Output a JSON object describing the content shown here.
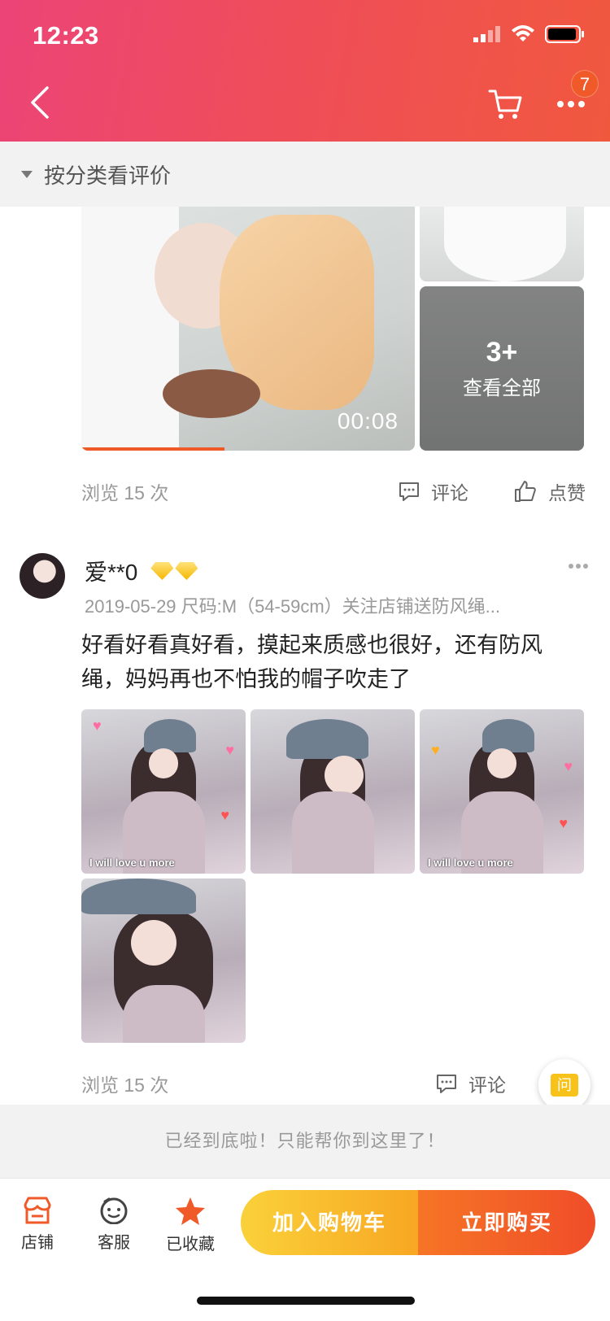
{
  "status_bar": {
    "time": "12:23"
  },
  "header": {
    "cart_badge": "7"
  },
  "category_bar": {
    "label": "按分类看评价"
  },
  "review1": {
    "video_duration": "00:08",
    "video_progress": 0.43,
    "view_all_count": "3+",
    "view_all_label": "查看全部",
    "views": "浏览 15 次",
    "comment_label": "评论",
    "like_label": "点赞"
  },
  "review2": {
    "username": "爱**0",
    "meta": "2019-05-29 尺码:M（54-59cm）关注店铺送防风绳...",
    "text": "好看好看真好看，摸起来质感也很好，还有防风绳，妈妈再也不怕我的帽子吹走了",
    "photo_caption": "I will love u more",
    "views": "浏览 15 次",
    "comment_label": "评论"
  },
  "ask_button": {
    "label": "问"
  },
  "end_message": "已经到底啦！只能帮你到这里了！",
  "bottom_bar": {
    "shop_label": "店铺",
    "service_label": "客服",
    "favorite_label": "已收藏",
    "add_to_cart_label": "加入购物车",
    "buy_now_label": "立即购买"
  },
  "colors": {
    "accent": "#f05a28",
    "header_start": "#ec4477",
    "header_end": "#f0583e",
    "cart_button": "#fad13a",
    "buy_button": "#f04d28"
  },
  "icons": [
    "back-icon",
    "cart-icon",
    "more-icon",
    "comment-icon",
    "like-icon",
    "shop-icon",
    "service-icon",
    "star-icon"
  ]
}
